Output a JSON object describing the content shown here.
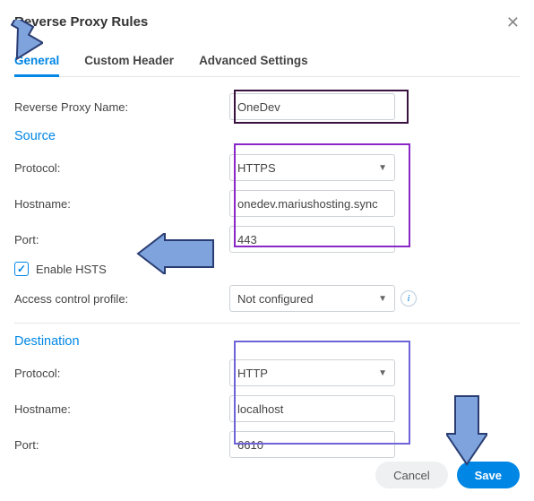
{
  "dialog": {
    "title": "Reverse Proxy Rules"
  },
  "tabs": {
    "general": "General",
    "custom_header": "Custom Header",
    "advanced": "Advanced Settings"
  },
  "labels": {
    "name": "Reverse Proxy Name:",
    "protocol": "Protocol:",
    "hostname": "Hostname:",
    "port": "Port:",
    "enable_hsts": "Enable HSTS",
    "access_profile": "Access control profile:"
  },
  "sections": {
    "source": "Source",
    "destination": "Destination"
  },
  "values": {
    "name": "OneDev",
    "src_protocol": "HTTPS",
    "src_hostname": "onedev.mariushosting.sync",
    "src_port": "443",
    "hsts_checked": true,
    "access_profile": "Not configured",
    "dst_protocol": "HTTP",
    "dst_hostname": "localhost",
    "dst_port": "6610"
  },
  "buttons": {
    "cancel": "Cancel",
    "save": "Save"
  },
  "colors": {
    "accent": "#0086e5",
    "arrow_fill": "#7ea3dd",
    "arrow_stroke": "#2a3d72"
  }
}
